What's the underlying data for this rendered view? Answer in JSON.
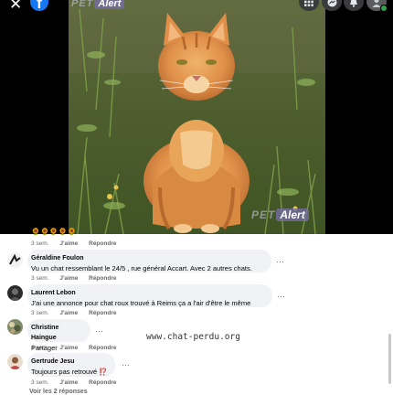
{
  "viewer": {
    "watermark_pet": "PET",
    "watermark_alert": "Alert",
    "close_symbol": "✕",
    "fb_letter": "f"
  },
  "comments": [
    {
      "author": "Géraldine Foulon",
      "text": "Vu un chat ressemblant le 24/5 , rue général Accart. Avec 2 autres chats.",
      "time": "3 sem.",
      "like": "J'aime",
      "reply": "Répondre"
    },
    {
      "author": "Laurent Lebon",
      "text": "J'ai une annonce pour chat roux trouvé à Reims ça a l'air d'être le même",
      "time": "3 sem.",
      "like": "J'aime",
      "reply": "Répondre"
    },
    {
      "author": "Christine Haingue",
      "text": "Partager",
      "time": "3 sem.",
      "like": "J'aime",
      "reply": "Répondre"
    },
    {
      "author": "Gertrude Jesu",
      "text": "Toujours pas retrouvé ⁉️",
      "time": "3 sem.",
      "like": "J'aime",
      "reply": "Répondre"
    }
  ],
  "first_meta": {
    "time": "3 sem.",
    "like": "J'aime",
    "reply": "Répondre"
  },
  "more_dots": "···",
  "site_watermark": "www.chat-perdu.org",
  "view_more": "Voir les 2 réponses"
}
